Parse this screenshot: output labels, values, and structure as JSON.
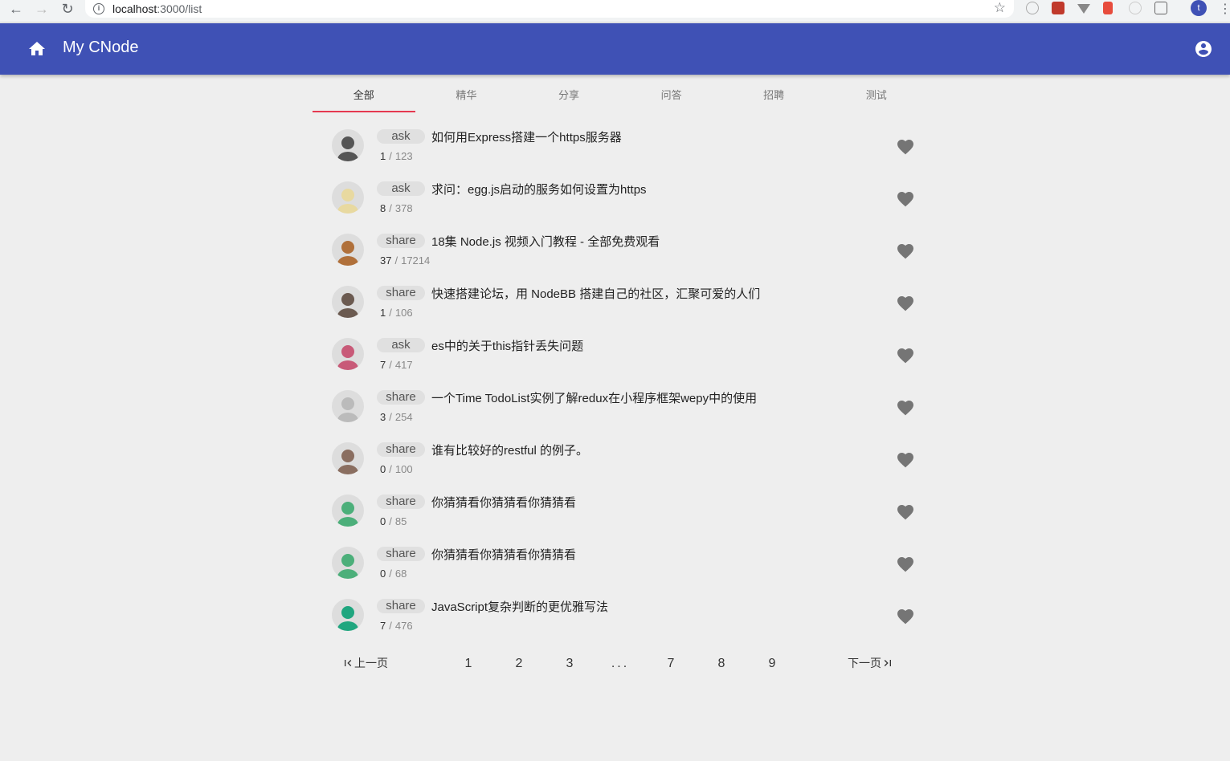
{
  "browser": {
    "url_host": "localhost",
    "url_path": ":3000/list",
    "profile_initial": "t"
  },
  "appbar": {
    "title": "My CNode",
    "home_icon": "home-icon",
    "account_icon": "account-circle-icon",
    "color": "#3f51b5"
  },
  "tabs": [
    {
      "label": "全部",
      "active": true
    },
    {
      "label": "精华",
      "active": false
    },
    {
      "label": "分享",
      "active": false
    },
    {
      "label": "问答",
      "active": false
    },
    {
      "label": "招聘",
      "active": false
    },
    {
      "label": "测试",
      "active": false
    }
  ],
  "topics": [
    {
      "tab": "ask",
      "title": "如何用Express搭建一个https服务器",
      "replies": "1",
      "visits": "123",
      "avatar": "#555"
    },
    {
      "tab": "ask",
      "title": "求问：egg.js启动的服务如何设置为https",
      "replies": "8",
      "visits": "378",
      "avatar": "#e8d9a0"
    },
    {
      "tab": "share",
      "title": "18集 Node.js 视频入门教程 - 全部免费观看",
      "replies": "37",
      "visits": "17214",
      "avatar": "#b0703a"
    },
    {
      "tab": "share",
      "title": "快速搭建论坛，用 NodeBB 搭建自己的社区，汇聚可爱的人们",
      "replies": "1",
      "visits": "106",
      "avatar": "#6b5a50"
    },
    {
      "tab": "ask",
      "title": "es中的关于this指针丢失问题",
      "replies": "7",
      "visits": "417",
      "avatar": "#c85a78"
    },
    {
      "tab": "share",
      "title": "一个Time TodoList实例了解redux在小程序框架wepy中的使用",
      "replies": "3",
      "visits": "254",
      "avatar": "#bbbbbb"
    },
    {
      "tab": "share",
      "title": "谁有比较好的restful 的例子。",
      "replies": "0",
      "visits": "100",
      "avatar": "#8a6e60"
    },
    {
      "tab": "share",
      "title": "你猜猜看你猜猜看你猜猜看",
      "replies": "0",
      "visits": "85",
      "avatar": "#4caf7a"
    },
    {
      "tab": "share",
      "title": "你猜猜看你猜猜看你猜猜看",
      "replies": "0",
      "visits": "68",
      "avatar": "#4caf7a"
    },
    {
      "tab": "share",
      "title": "JavaScript复杂判断的更优雅写法",
      "replies": "7",
      "visits": "476",
      "avatar": "#20a67f"
    }
  ],
  "stats_sep": "/",
  "pagination": {
    "prev_label": "上一页",
    "next_label": "下一页",
    "pages": [
      "1",
      "2",
      "3",
      "...",
      "7",
      "8",
      "9"
    ]
  }
}
